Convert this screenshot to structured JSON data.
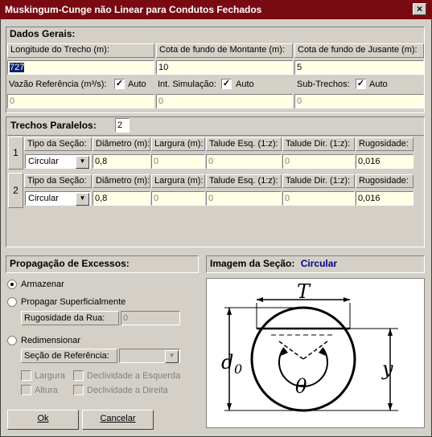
{
  "window": {
    "title": "Muskingum-Cunge não Linear para Condutos Fechados",
    "close": "×"
  },
  "dados_gerais": {
    "header": "Dados Gerais:",
    "longitude_label": "Longitude do Trecho (m):",
    "longitude_value": "727",
    "cota_montante_label": "Cota de fundo de Montante (m):",
    "cota_montante_value": "10",
    "cota_jusante_label": "Cota de fundo de Jusante (m):",
    "cota_jusante_value": "5",
    "vazao_label": "Vazão Referência  (m³/s):",
    "vazao_auto": "Auto",
    "vazao_value": "0",
    "simulacao_label": "Int. Simulação:",
    "simulacao_auto": "Auto",
    "simulacao_value": "0",
    "subtrechos_label": "Sub-Trechos:",
    "subtrechos_auto": "Auto",
    "subtrechos_value": "0",
    "check_mark": "✓"
  },
  "trechos": {
    "header": "Trechos Paralelos:",
    "count": "2",
    "columns": [
      "Tipo da Seção:",
      "Diâmetro (m):",
      "Largura (m):",
      "Talude Esq. (1:z):",
      "Talude Dir. (1:z):",
      "Rugosidade:"
    ],
    "rows": [
      {
        "num": "1",
        "tipo": "Circular",
        "diametro": "0,8",
        "largura": "0",
        "talude_esq": "0",
        "talude_dir": "0",
        "rugosidade": "0,016"
      },
      {
        "num": "2",
        "tipo": "Circular",
        "diametro": "0,8",
        "largura": "0",
        "talude_esq": "0",
        "talude_dir": "0",
        "rugosidade": "0,016"
      }
    ]
  },
  "propagacao": {
    "header": "Propagação de Excessos:",
    "armazenar": "Armazenar",
    "propagar": "Propagar Superficialmente",
    "rugosidade_rua_label": "Rugosidade da Rua:",
    "rugosidade_rua_value": "0",
    "redimensionar": "Redimensionar",
    "secao_ref_label": "Seção de Referência:",
    "secao_ref_value": "",
    "largura": "Largura",
    "altura": "Altura",
    "decl_esq": "Declividade a Esquerda",
    "decl_dir": "Declividade a Direita",
    "selected": "armazenar"
  },
  "imagem": {
    "header_label": "Imagem da Seção:",
    "header_value": "Circular",
    "accent": "#00008b",
    "diagram_labels": {
      "T": "T",
      "d0": "d",
      "d0_sub": "0",
      "y": "y",
      "theta": "θ"
    }
  },
  "buttons": {
    "ok": "Ok",
    "cancel": "Cancelar"
  },
  "colors": {
    "titlebar": "#7a0a12",
    "input_bg": "#ffffe6",
    "face": "#d4d0c8",
    "selection": "#0a246a"
  }
}
